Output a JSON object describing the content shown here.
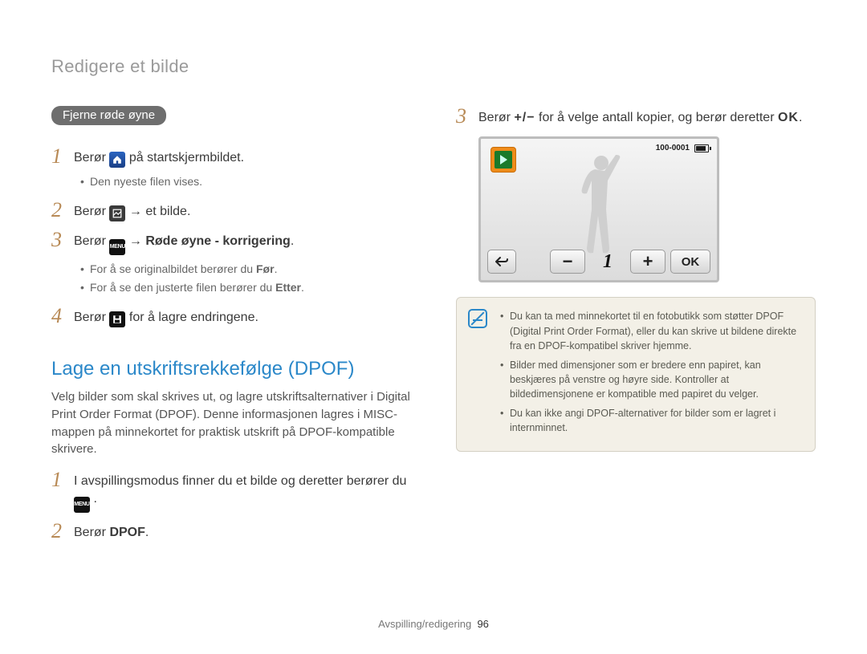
{
  "page_title": "Redigere et bilde",
  "section_redeye": {
    "pill": "Fjerne røde øyne",
    "steps": [
      {
        "n": "1",
        "pre": "Berør ",
        "icon": "home",
        "post": " på startskjermbildet.",
        "bullets": [
          "Den nyeste filen vises."
        ]
      },
      {
        "n": "2",
        "pre": "Berør ",
        "icon": "grid",
        "post_html": " → et bilde."
      },
      {
        "n": "3",
        "pre": "Berør ",
        "icon": "menu",
        "post_bold": " → Røde øyne - korrigering",
        "post_after_bold": ".",
        "bullets": [
          "For å se originalbildet berører du Før.",
          "For å se den justerte filen berører du Etter."
        ],
        "bullet_bold_words": {
          "0": "Før",
          "1": "Etter"
        }
      },
      {
        "n": "4",
        "pre": "Berør ",
        "icon": "save",
        "post": " for å lagre endringene."
      }
    ]
  },
  "section_dpof": {
    "title": "Lage en utskriftsrekkefølge (DPOF)",
    "intro": "Velg bilder som skal skrives ut, og lagre utskriftsalternativer i Digital Print Order Format (DPOF). Denne informasjonen lagres i MISC-mappen på minnekortet for praktisk utskrift på DPOF-kompatible skrivere.",
    "steps": [
      {
        "n": "1",
        "text_pre": "I avspillingsmodus finner du et bilde og deretter berører du ",
        "icon": "menu",
        "text_post": "."
      },
      {
        "n": "2",
        "text_pre": "Berør ",
        "bold": "DPOF",
        "text_post": "."
      }
    ]
  },
  "right_step": {
    "n": "3",
    "text_pre": "Berør ",
    "plusminus": "+/−",
    "text_mid": " for å velge antall kopier, og berør deretter ",
    "ok": "OK",
    "text_post": "."
  },
  "screen": {
    "file_counter": "100-0001",
    "count": "1",
    "ok_label": "OK"
  },
  "info_box": {
    "items": [
      "Du kan ta med minnekortet til en fotobutikk som støtter DPOF (Digital Print Order Format), eller du kan skrive ut bildene direkte fra en DPOF-kompatibel skriver hjemme.",
      "Bilder med dimensjoner som er bredere enn papiret, kan beskjæres på venstre og høyre side. Kontroller at bildedimensjonene er kompatible med papiret du velger.",
      "Du kan ikke angi DPOF-alternativer for bilder som er lagret i internminnet."
    ]
  },
  "footer": {
    "section": "Avspilling/redigering",
    "page": "96"
  }
}
